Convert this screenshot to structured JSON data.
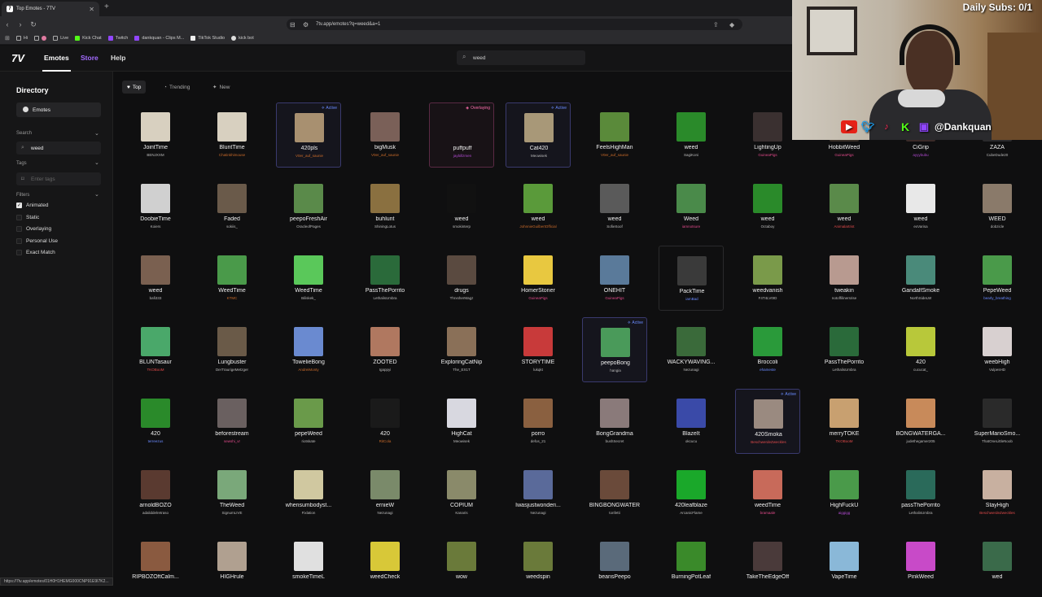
{
  "browser": {
    "tab_title": "Top Emotes - 7TV",
    "url": "7tv.app/emotes?q=weed&a=1",
    "bookmarks": [
      "Hi",
      "",
      "Live",
      "Kick Chat",
      "Twitch",
      "dankquan - Clips M...",
      "TikTok Studio",
      "kick bot"
    ],
    "status_url": "https://7tv.app/emotes/01H0H1HEMG000CNP91E9I7K2..."
  },
  "header": {
    "nav": [
      "Emotes",
      "Store",
      "Help"
    ],
    "search_value": "weed"
  },
  "sidebar": {
    "title": "Directory",
    "emotes_item": "Emotes",
    "search_label": "Search",
    "search_value": "weed",
    "tags_label": "Tags",
    "tags_placeholder": "Enter tags",
    "filters_label": "Filters",
    "filters": [
      {
        "label": "Animated",
        "checked": true
      },
      {
        "label": "Static",
        "checked": false
      },
      {
        "label": "Overlaying",
        "checked": false
      },
      {
        "label": "Personal Use",
        "checked": false
      },
      {
        "label": "Exact Match",
        "checked": false
      }
    ]
  },
  "filters": [
    "Top",
    "Trending",
    "New"
  ],
  "badges": {
    "active": "Active",
    "overlaying": "Overlaying"
  },
  "emotes": [
    [
      {
        "name": "JointTime",
        "author": "BENJXXM",
        "author_color": "#bbbbbb",
        "state": "",
        "color": "#d8d0c0"
      },
      {
        "name": "BluntTime",
        "author": "Chatinkhimouse",
        "author_color": "#c86a2a",
        "state": "",
        "color": "#d8d0c0"
      },
      {
        "name": "420pls",
        "author": "V0er_auf_saunie",
        "author_color": "#c86a2a",
        "state": "active",
        "color": "#a89070"
      },
      {
        "name": "bigMusk",
        "author": "V0er_auf_saunie",
        "author_color": "#c86a2a",
        "state": "",
        "color": "#7a6058"
      },
      {
        "name": "puffpuff",
        "author": "jaybillzmen",
        "author_color": "#b04ad0",
        "state": "overlay",
        "color": "#181216"
      },
      {
        "name": "Cat420",
        "author": "Meowisek",
        "author_color": "#bbbbbb",
        "state": "active",
        "color": "#a89878"
      },
      {
        "name": "FeelsHighMan",
        "author": "V0er_auf_saunie",
        "author_color": "#c86a2a",
        "state": "",
        "color": "#5a8a3a"
      },
      {
        "name": "weed",
        "author": "SagiKoni",
        "author_color": "#bbbbbb",
        "state": "",
        "color": "#2a8a2a"
      },
      {
        "name": "LightingUp",
        "author": "GuineaPigs",
        "author_color": "#e04a8a",
        "state": "",
        "color": "#3a3030"
      },
      {
        "name": "HobbitWeed",
        "author": "GuineaPigs",
        "author_color": "#e04a8a",
        "state": "",
        "color": "#3a3028"
      },
      {
        "name": "CiGrip",
        "author": "ayyybubu",
        "author_color": "#b04ad0",
        "state": "",
        "color": "#3a2a28"
      },
      {
        "name": "ZAZA",
        "author": "CubeDude20",
        "author_color": "#bbbbbb",
        "state": "",
        "color": "#2a2a2c"
      }
    ],
    [
      {
        "name": "DoobieTime",
        "author": "Koiers",
        "author_color": "#bbbbbb",
        "state": "",
        "color": "#d0d0d0"
      },
      {
        "name": "Faded",
        "author": "sokiis_",
        "author_color": "#bbbbbb",
        "state": "",
        "color": "#6a5a4a"
      },
      {
        "name": "peepoFreshAir",
        "author": "OracleofPages",
        "author_color": "#bbbbbb",
        "state": "",
        "color": "#5a8a4a"
      },
      {
        "name": "buhlunt",
        "author": "ShiningLotus",
        "author_color": "#bbbbbb",
        "state": "",
        "color": "#8a7040"
      },
      {
        "name": "weed",
        "author": "smokinterp",
        "author_color": "#bbbbbb",
        "state": "",
        "color": "#111111"
      },
      {
        "name": "weed",
        "author": "JohnnieGuilbertOfficial",
        "author_color": "#c86a2a",
        "state": "",
        "color": "#5a9a3a"
      },
      {
        "name": "weed",
        "author": "SofieSoof",
        "author_color": "#bbbbbb",
        "state": "",
        "color": "#5a5a5a"
      },
      {
        "name": "Weed",
        "author": "iamnotsure",
        "author_color": "#e04a8a",
        "state": "",
        "color": "#4a8a4a"
      },
      {
        "name": "weed",
        "author": "Octaboy",
        "author_color": "#bbbbbb",
        "state": "",
        "color": "#2a8a2a"
      },
      {
        "name": "weed",
        "author": "Animalartrist",
        "author_color": "#e04a4a",
        "state": "",
        "color": "#5a8a4a"
      },
      {
        "name": "weed",
        "author": "exVarisa",
        "author_color": "#bbbbbb",
        "state": "",
        "color": "#e8e8e8"
      },
      {
        "name": "WEED",
        "author": "dobzicle",
        "author_color": "#bbbbbb",
        "state": "",
        "color": "#8a7a6a"
      }
    ],
    [
      {
        "name": "weed",
        "author": "bafi333",
        "author_color": "#bbbbbb",
        "state": "",
        "color": "#7a6050"
      },
      {
        "name": "WeedTime",
        "author": "KTMC",
        "author_color": "#c86a2a",
        "state": "",
        "color": "#4a9a4a"
      },
      {
        "name": "WeedTime",
        "author": "Biliskek_",
        "author_color": "#bbbbbb",
        "state": "",
        "color": "#5ac85a"
      },
      {
        "name": "PassThePorrito",
        "author": "LethalisUmbra",
        "author_color": "#bbbbbb",
        "state": "",
        "color": "#2a6a3a"
      },
      {
        "name": "drugs",
        "author": "ThrxsherMagz",
        "author_color": "#bbbbbb",
        "state": "",
        "color": "#5a4a40"
      },
      {
        "name": "HomerStoner",
        "author": "GuineaPigs",
        "author_color": "#e04a8a",
        "state": "",
        "color": "#e8c840"
      },
      {
        "name": "ONEHIT",
        "author": "GuineaPigs",
        "author_color": "#e04a8a",
        "state": "",
        "color": "#5a7a9a"
      },
      {
        "name": "PackTime",
        "author": "iamBad",
        "author_color": "#6a8aff",
        "state": "plain",
        "color": "#3a3a3a"
      },
      {
        "name": "weedvanish",
        "author": "F4T4LV0ID",
        "author_color": "#bbbbbb",
        "state": "",
        "color": "#7a9a4a"
      },
      {
        "name": "tweakin",
        "author": "notoffilinersrise",
        "author_color": "#bbbbbb",
        "state": "",
        "color": "#b89a90"
      },
      {
        "name": "GandalfSmoke",
        "author": "NorthSideLW",
        "author_color": "#bbbbbb",
        "state": "",
        "color": "#4a8a7a"
      },
      {
        "name": "PepeWeed",
        "author": "bearly_breathing",
        "author_color": "#6a8aff",
        "state": "",
        "color": "#4a9a4a"
      }
    ],
    [
      {
        "name": "BLUNTasaur",
        "author": "TKOBooM",
        "author_color": "#e04a4a",
        "state": "",
        "color": "#4aa86a"
      },
      {
        "name": "Lungbuster",
        "author": "DerTraurigeMetzger",
        "author_color": "#bbbbbb",
        "state": "",
        "color": "#6a5a48"
      },
      {
        "name": "TowelieBong",
        "author": "AndreiMonty",
        "author_color": "#c86a2a",
        "state": "",
        "color": "#6a8ad0"
      },
      {
        "name": "ZOOTED",
        "author": "Igappyi",
        "author_color": "#bbbbbb",
        "state": "",
        "color": "#b07860"
      },
      {
        "name": "ExploringCatNip",
        "author": "The_EX1T",
        "author_color": "#bbbbbb",
        "state": "",
        "color": "#8a7058"
      },
      {
        "name": "STORYTIME",
        "author": "lukqkt",
        "author_color": "#bbbbbb",
        "state": "",
        "color": "#c83a3a"
      },
      {
        "name": "peepoBong",
        "author": "hangia",
        "author_color": "#bbbbbb",
        "state": "active",
        "color": "#4a9a5a"
      },
      {
        "name": "WACKYWAVING...",
        "author": "Nezunagi",
        "author_color": "#bbbbbb",
        "state": "",
        "color": "#3a6a3a"
      },
      {
        "name": "Broccoli",
        "author": "ehameste",
        "author_color": "#6a8aff",
        "state": "",
        "color": "#2a9a3a"
      },
      {
        "name": "PassThePorrito",
        "author": "LethalisUmbra",
        "author_color": "#bbbbbb",
        "state": "",
        "color": "#2a6a3a"
      },
      {
        "name": "420",
        "author": "cucucat_",
        "author_color": "#bbbbbb",
        "state": "",
        "color": "#b8c83a"
      },
      {
        "name": "weebHigh",
        "author": "VulpesHD",
        "author_color": "#bbbbbb",
        "state": "",
        "color": "#d8d0d0"
      }
    ],
    [
      {
        "name": "420",
        "author": "terreezus",
        "author_color": "#6a8aff",
        "state": "",
        "color": "#2a8a2a"
      },
      {
        "name": "beforestream",
        "author": "sewshi_vr",
        "author_color": "#e04a8a",
        "state": "",
        "color": "#6a6060"
      },
      {
        "name": "pepeWeed",
        "author": "riotskate",
        "author_color": "#bbbbbb",
        "state": "",
        "color": "#6a9a4a"
      },
      {
        "name": "420",
        "author": "RitCola",
        "author_color": "#c86a2a",
        "state": "",
        "color": "#1a1a1a"
      },
      {
        "name": "HighCat",
        "author": "Meowisek",
        "author_color": "#bbbbbb",
        "state": "",
        "color": "#d8d8e0"
      },
      {
        "name": "porro",
        "author": "defos_21",
        "author_color": "#bbbbbb",
        "state": "",
        "color": "#8a6040"
      },
      {
        "name": "BongGrandma",
        "author": "bushSecret",
        "author_color": "#bbbbbb",
        "state": "",
        "color": "#8a7a7a"
      },
      {
        "name": "BlazeIt",
        "author": "okcucu",
        "author_color": "#bbbbbb",
        "state": "",
        "color": "#3a4aa8"
      },
      {
        "name": "420Smoka",
        "author": "BeschwerdeZweckles",
        "author_color": "#e04a4a",
        "state": "active",
        "color": "#9a8a80"
      },
      {
        "name": "merryTOKE",
        "author": "TKOBooM",
        "author_color": "#e04a4a",
        "state": "",
        "color": "#c8a070"
      },
      {
        "name": "BONGWATERGA...",
        "author": "judethegamer205",
        "author_color": "#bbbbbb",
        "state": "",
        "color": "#c88a5a"
      },
      {
        "name": "SuperMarioSmo...",
        "author": "ThatOneLittleNoob",
        "author_color": "#bbbbbb",
        "state": "",
        "color": "#2a2a2a"
      }
    ],
    [
      {
        "name": "arnoldBOZO",
        "author": "adaliddelretraso",
        "author_color": "#bbbbbb",
        "state": "",
        "color": "#5a3a30"
      },
      {
        "name": "TheWeed",
        "author": "SignumLIVE",
        "author_color": "#bbbbbb",
        "state": "",
        "color": "#7aa87a"
      },
      {
        "name": "whensumbodyst...",
        "author": "Fixlation",
        "author_color": "#bbbbbb",
        "state": "",
        "color": "#d0c8a0"
      },
      {
        "name": "ernieW",
        "author": "Nezunagi",
        "author_color": "#bbbbbb",
        "state": "",
        "color": "#7a8a6a"
      },
      {
        "name": "COPIUM",
        "author": "Kanaris",
        "author_color": "#bbbbbb",
        "state": "",
        "color": "#8a8a6a"
      },
      {
        "name": "Iwasjustwonderi...",
        "author": "Nezunagi",
        "author_color": "#bbbbbb",
        "state": "",
        "color": "#5a6a9a"
      },
      {
        "name": "BINGBONGWATER",
        "author": "tonfetti",
        "author_color": "#bbbbbb",
        "state": "",
        "color": "#6a4a3a"
      },
      {
        "name": "420leafblaze",
        "author": "ArcanicFlame",
        "author_color": "#bbbbbb",
        "state": "",
        "color": "#1aa82a"
      },
      {
        "name": "weedTime",
        "author": "bramaale",
        "author_color": "#e04a8a",
        "state": "",
        "color": "#c86a5a"
      },
      {
        "name": "HighFuckU",
        "author": "aiggigg",
        "author_color": "#b04ad0",
        "state": "",
        "color": "#4a9a4a"
      },
      {
        "name": "passThePorrito",
        "author": "LethalisUmbra",
        "author_color": "#bbbbbb",
        "state": "",
        "color": "#2a6a5a"
      },
      {
        "name": "StayHigh",
        "author": "BeschwerdeZweckles",
        "author_color": "#e04a4a",
        "state": "",
        "color": "#c8b0a0"
      }
    ],
    [
      {
        "name": "RIPBOZOftCalm...",
        "author": "",
        "author_color": "#bbbbbb",
        "state": "",
        "color": "#8a5a40"
      },
      {
        "name": "HIGHrule",
        "author": "",
        "author_color": "#bbbbbb",
        "state": "",
        "color": "#b0a090"
      },
      {
        "name": "smokeTimeL",
        "author": "",
        "author_color": "#bbbbbb",
        "state": "",
        "color": "#e0e0e0"
      },
      {
        "name": "weedCheck",
        "author": "",
        "author_color": "#bbbbbb",
        "state": "",
        "color": "#d8c838"
      },
      {
        "name": "wow",
        "author": "",
        "author_color": "#bbbbbb",
        "state": "",
        "color": "#6a7a3a"
      },
      {
        "name": "weedspin",
        "author": "",
        "author_color": "#bbbbbb",
        "state": "",
        "color": "#6a7a3a"
      },
      {
        "name": "beansPeepo",
        "author": "",
        "author_color": "#bbbbbb",
        "state": "",
        "color": "#5a6a7a"
      },
      {
        "name": "BurningPotLeaf",
        "author": "",
        "author_color": "#bbbbbb",
        "state": "",
        "color": "#3a8a2a"
      },
      {
        "name": "TakeTheEdgeOff",
        "author": "",
        "author_color": "#bbbbbb",
        "state": "",
        "color": "#4a3a3a"
      },
      {
        "name": "VapeTime",
        "author": "",
        "author_color": "#bbbbbb",
        "state": "",
        "color": "#8ab8d8"
      },
      {
        "name": "PinkWeed",
        "author": "",
        "author_color": "#bbbbbb",
        "state": "",
        "color": "#c84ac8"
      },
      {
        "name": "wed",
        "author": "",
        "author_color": "#bbbbbb",
        "state": "",
        "color": "#3a6a4a"
      }
    ]
  ],
  "overlay": {
    "daily_subs": "Daily Subs: 0/1",
    "handle": "@Dankquan"
  }
}
